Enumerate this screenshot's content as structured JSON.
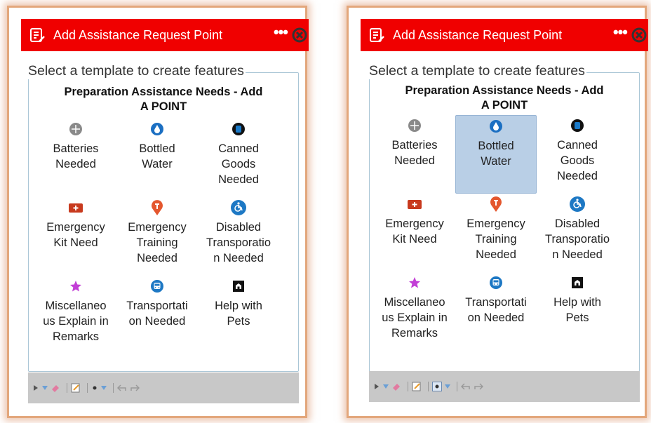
{
  "header": {
    "title": "Add Assistance Request Point",
    "more": "•••"
  },
  "instructions": "Select a template to create features",
  "group": {
    "title_line1": "Preparation Assistance Needs - Add",
    "title_line2": "A POINT"
  },
  "templates": [
    {
      "label": "Batteries\nNeeded",
      "icon": "batteries-icon"
    },
    {
      "label": "Bottled\nWater",
      "icon": "water-drop-icon"
    },
    {
      "label": "Canned\nGoods\nNeeded",
      "icon": "canned-goods-icon"
    },
    {
      "label": "Emergency\nKit Need",
      "icon": "first-aid-kit-icon"
    },
    {
      "label": "Emergency\nTraining\nNeeded",
      "icon": "training-pin-icon"
    },
    {
      "label": "Disabled\nTransporatio\nn Needed",
      "icon": "wheelchair-icon"
    },
    {
      "label": "Miscellaneo\nus Explain in\nRemarks",
      "icon": "star-icon"
    },
    {
      "label": "Transportati\non Needed",
      "icon": "bus-icon"
    },
    {
      "label": "Help with\nPets",
      "icon": "pet-icon"
    }
  ],
  "panels": [
    {
      "selected": ""
    },
    {
      "selected": "Bottled Water"
    }
  ],
  "colors": {
    "header_bg": "#f00000",
    "selected_bg": "#b9cfe6",
    "frame_border": "#e3a77c"
  }
}
